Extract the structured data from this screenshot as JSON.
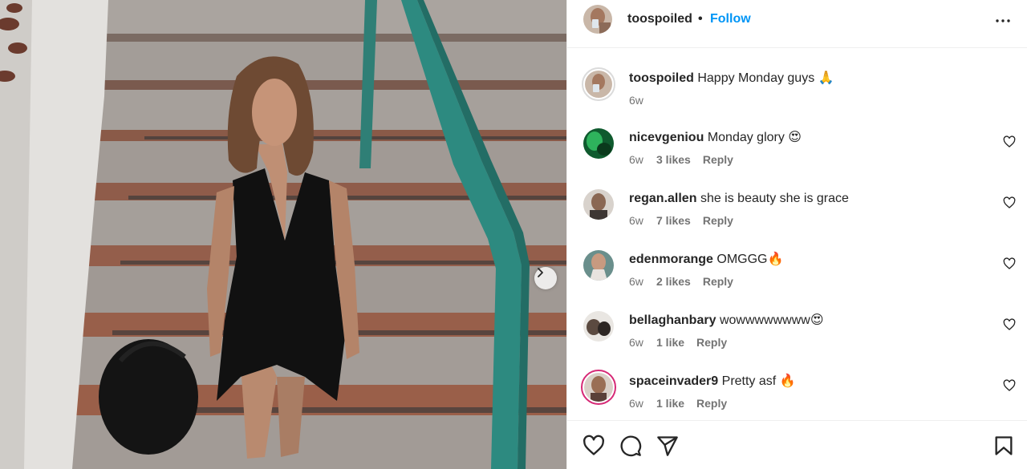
{
  "post": {
    "author": "toospoiled",
    "dot": "•",
    "follow_label": "Follow",
    "icons": {
      "more": "more-options-icon",
      "next": "chevron-right-icon",
      "like": "heart-icon",
      "comment": "comment-icon",
      "share": "share-icon",
      "save": "bookmark-icon"
    }
  },
  "caption": {
    "username": "toospoiled",
    "text": "Happy Monday guys 🙏",
    "age": "6w"
  },
  "comments": [
    {
      "username": "nicevgeniou",
      "text": "Monday glory 😍",
      "age": "6w",
      "likes": "3 likes",
      "reply": "Reply"
    },
    {
      "username": "regan.allen",
      "text": "she is beauty she is grace",
      "age": "6w",
      "likes": "7 likes",
      "reply": "Reply"
    },
    {
      "username": "edenmorange",
      "text": "OMGGG🔥",
      "age": "6w",
      "likes": "2 likes",
      "reply": "Reply"
    },
    {
      "username": "bellaghanbary",
      "text": "wowwwwwwww😍",
      "age": "6w",
      "likes": "1 like",
      "reply": "Reply"
    },
    {
      "username": "spaceinvader9",
      "text": "Pretty asf 🔥",
      "age": "6w",
      "likes": "1 like",
      "reply": "Reply"
    }
  ],
  "colors": {
    "link": "#0095f6",
    "text": "#262626",
    "muted": "#737373",
    "story_ring": "#d62976"
  }
}
